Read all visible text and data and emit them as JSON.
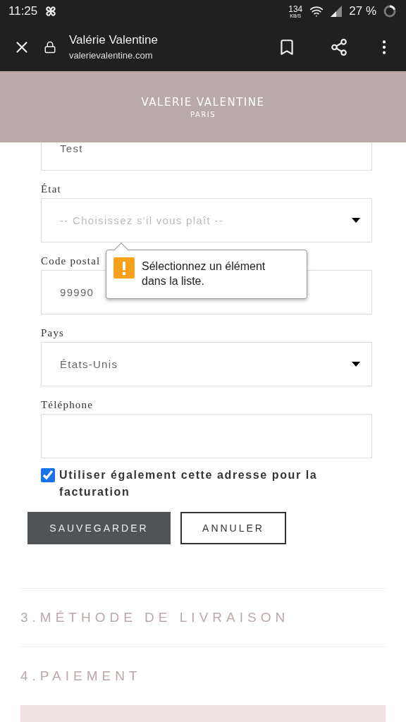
{
  "status_bar": {
    "time": "11:25",
    "speed": "134",
    "speed_unit": "KB/S",
    "battery": "27 %"
  },
  "browser": {
    "title": "Valérie Valentine",
    "url": "valerievalentine.com"
  },
  "brand": {
    "name": "VALERIE VALENTINE",
    "city": "PARIS"
  },
  "fields": [
    {
      "kind": "input",
      "value": "Test"
    },
    {
      "kind": "select",
      "label": "État",
      "placeholder": "-- Choisissez s'il vous plaît --"
    },
    {
      "kind": "input",
      "label": "Code postal",
      "value": "99990"
    },
    {
      "kind": "select",
      "label": "Pays",
      "value": "États-Unis"
    },
    {
      "kind": "input",
      "label": "Téléphone"
    }
  ],
  "tooltip": {
    "message": "Sélectionnez un élément dans la liste."
  },
  "billing_checkbox": {
    "label": "Utiliser également cette adresse pour la facturation",
    "checked": true
  },
  "buttons": [
    {
      "label": "SAUVEGARDER",
      "kind": "primary"
    },
    {
      "label": "ANNULER",
      "kind": "secondary"
    }
  ],
  "sections": [
    "3.MÉTHODE DE LIVRAISON",
    "4.PAIEMENT"
  ]
}
